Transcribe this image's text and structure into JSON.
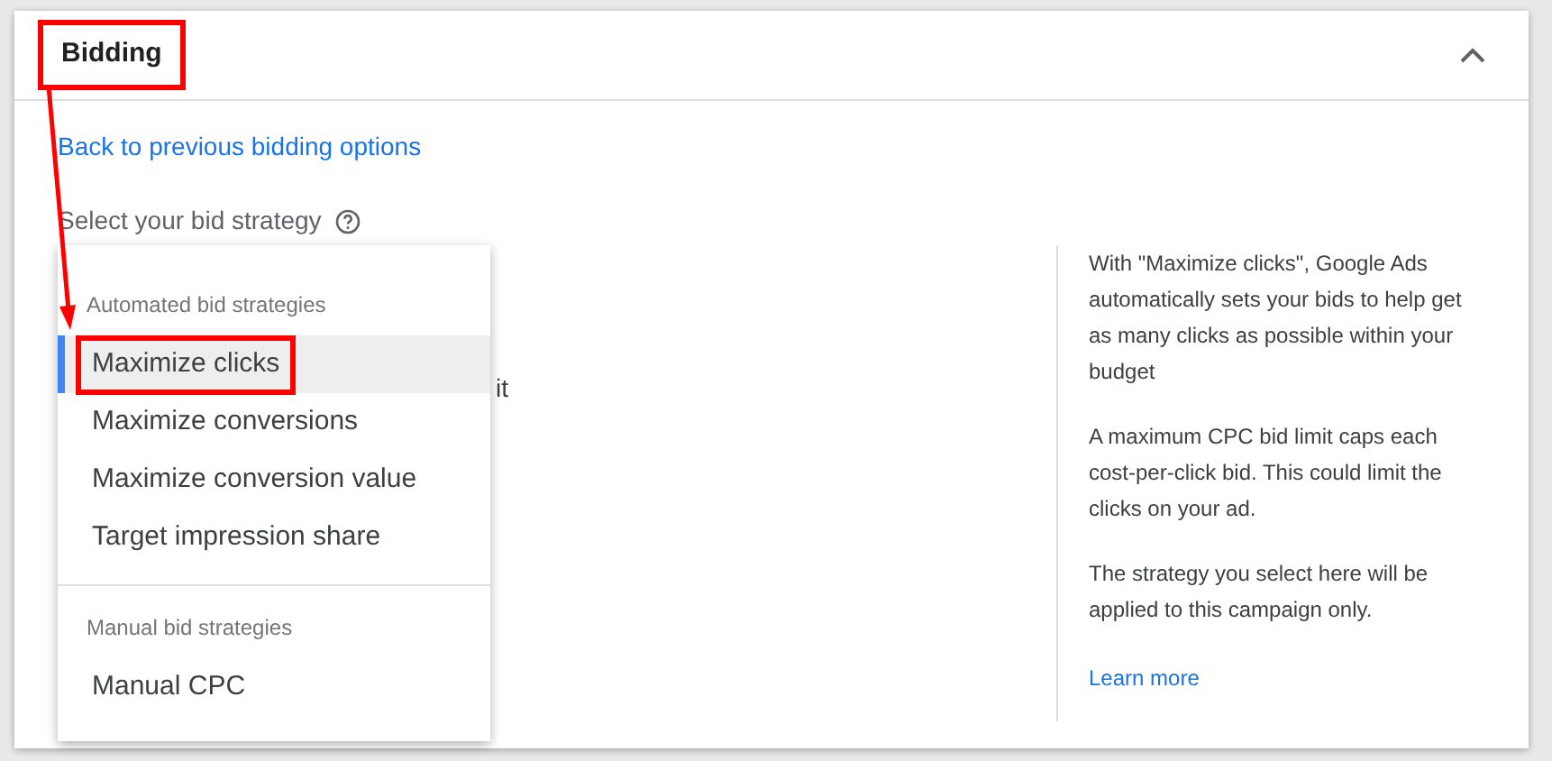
{
  "panel": {
    "title": "Bidding",
    "title_highlighted": true,
    "expanded": true
  },
  "back_link": "Back to previous bidding options",
  "strategy_label": "Select your bid strategy",
  "covered_text": "it",
  "menu": {
    "groups": [
      {
        "heading": "Automated bid strategies",
        "items": [
          {
            "label": "Maximize clicks",
            "selected": true,
            "highlighted": true
          },
          {
            "label": "Maximize conversions",
            "selected": false,
            "highlighted": false
          },
          {
            "label": "Maximize conversion value",
            "selected": false,
            "highlighted": false
          },
          {
            "label": "Target impression share",
            "selected": false,
            "highlighted": false
          }
        ]
      },
      {
        "heading": "Manual bid strategies",
        "items": [
          {
            "label": "Manual CPC",
            "selected": false,
            "highlighted": false
          }
        ]
      }
    ]
  },
  "annotation_arrow": true,
  "help": {
    "paragraphs": [
      "With \"Maximize clicks\", Google Ads automatically sets your bids to help get as many clicks as possible within your budget",
      "A maximum CPC bid limit caps each cost-per-click bid. This could limit the clicks on your ad.",
      "The strategy you select here will be applied to this campaign only."
    ],
    "link": "Learn more"
  }
}
